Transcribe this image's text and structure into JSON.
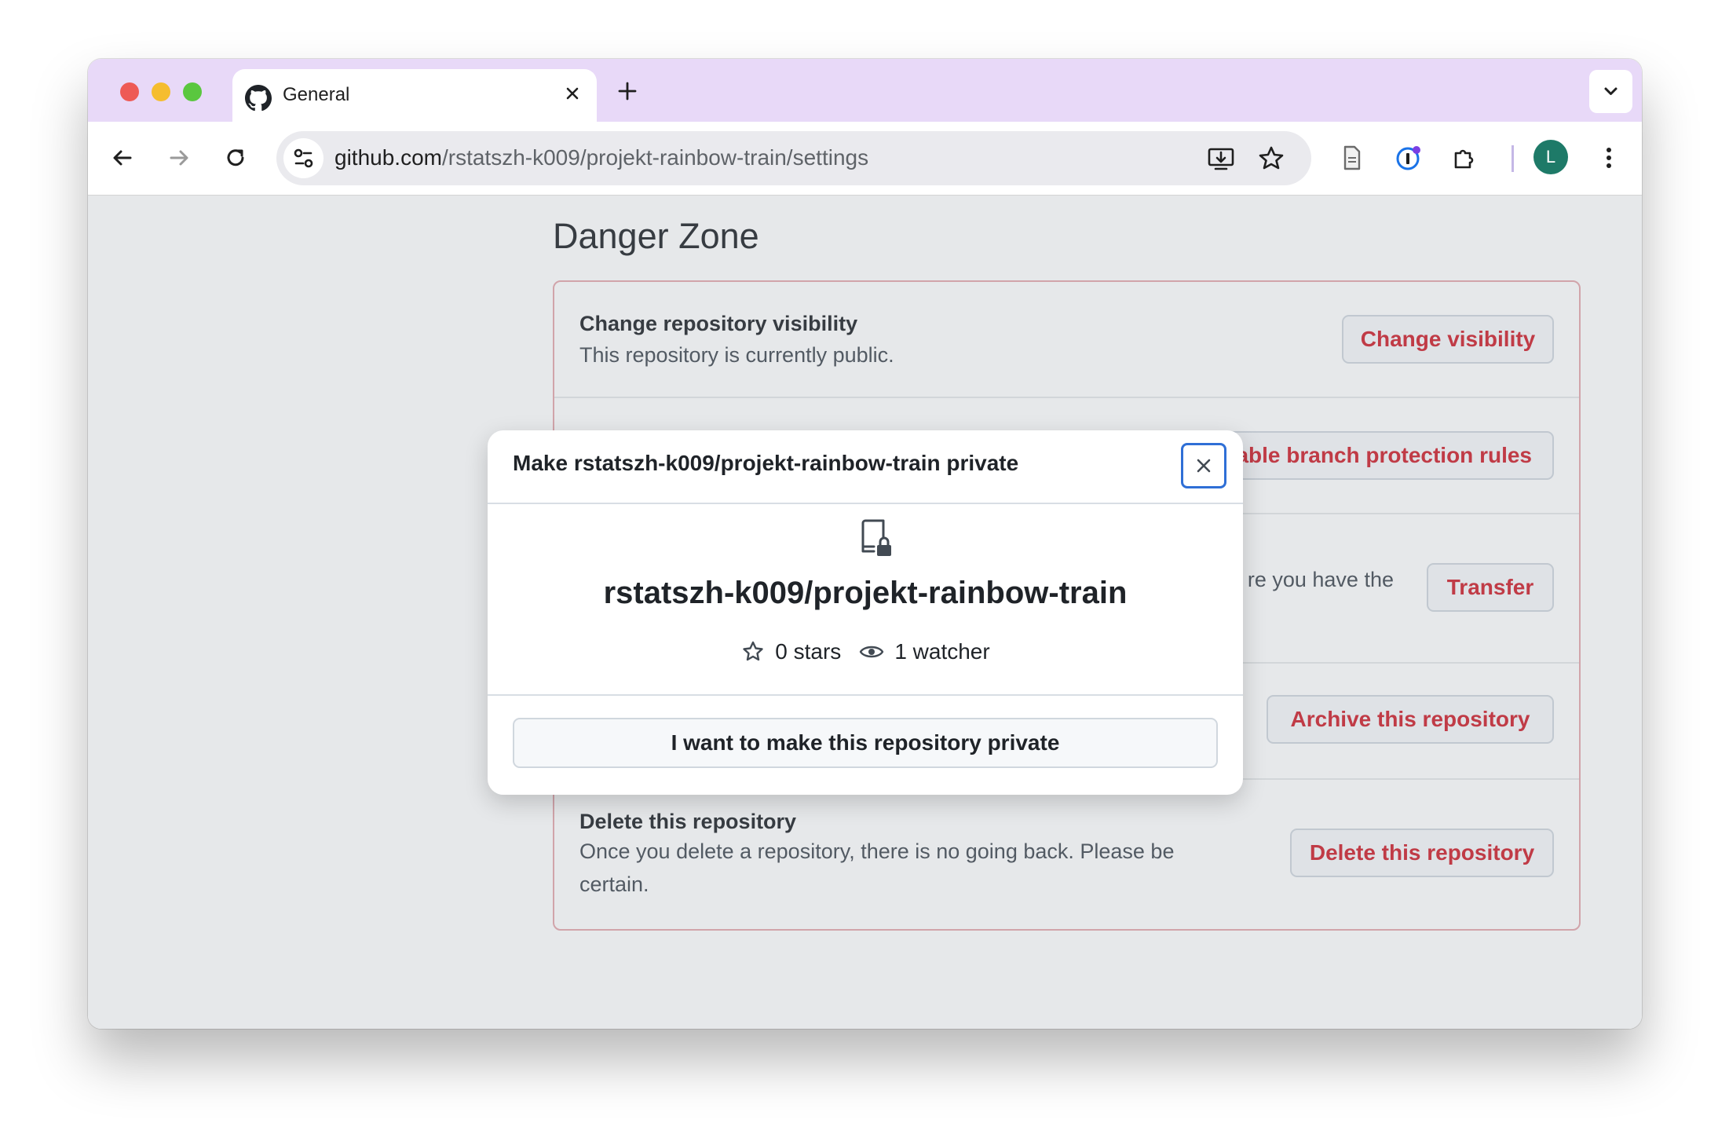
{
  "browser": {
    "tab_title": "General",
    "url_host": "github.com",
    "url_path": "/rstatszh-k009/projekt-rainbow-train/settings",
    "profile_initial": "L"
  },
  "page": {
    "section_title": "Danger Zone",
    "rows": [
      {
        "title": "Change repository visibility",
        "description": "This repository is currently public.",
        "button": "Change visibility"
      },
      {
        "title": "",
        "description": "",
        "button": "able branch protection rules"
      },
      {
        "title": "",
        "description": "re you have the",
        "button": "Transfer"
      },
      {
        "title": "",
        "description": "",
        "button": "Archive this repository"
      },
      {
        "title": "Delete this repository",
        "description": "Once you delete a repository, there is no going back. Please be certain.",
        "button": "Delete this repository"
      }
    ]
  },
  "dialog": {
    "title": "Make rstatszh-k009/projekt-rainbow-train private",
    "repo_full_name": "rstatszh-k009/projekt-rainbow-train",
    "stars": "0 stars",
    "watchers": "1 watcher",
    "confirm_button": "I want to make this repository private"
  },
  "colors": {
    "danger": "#cf222e",
    "tabbar": "#e8d9f8",
    "focus_ring": "#2f6fd6"
  }
}
